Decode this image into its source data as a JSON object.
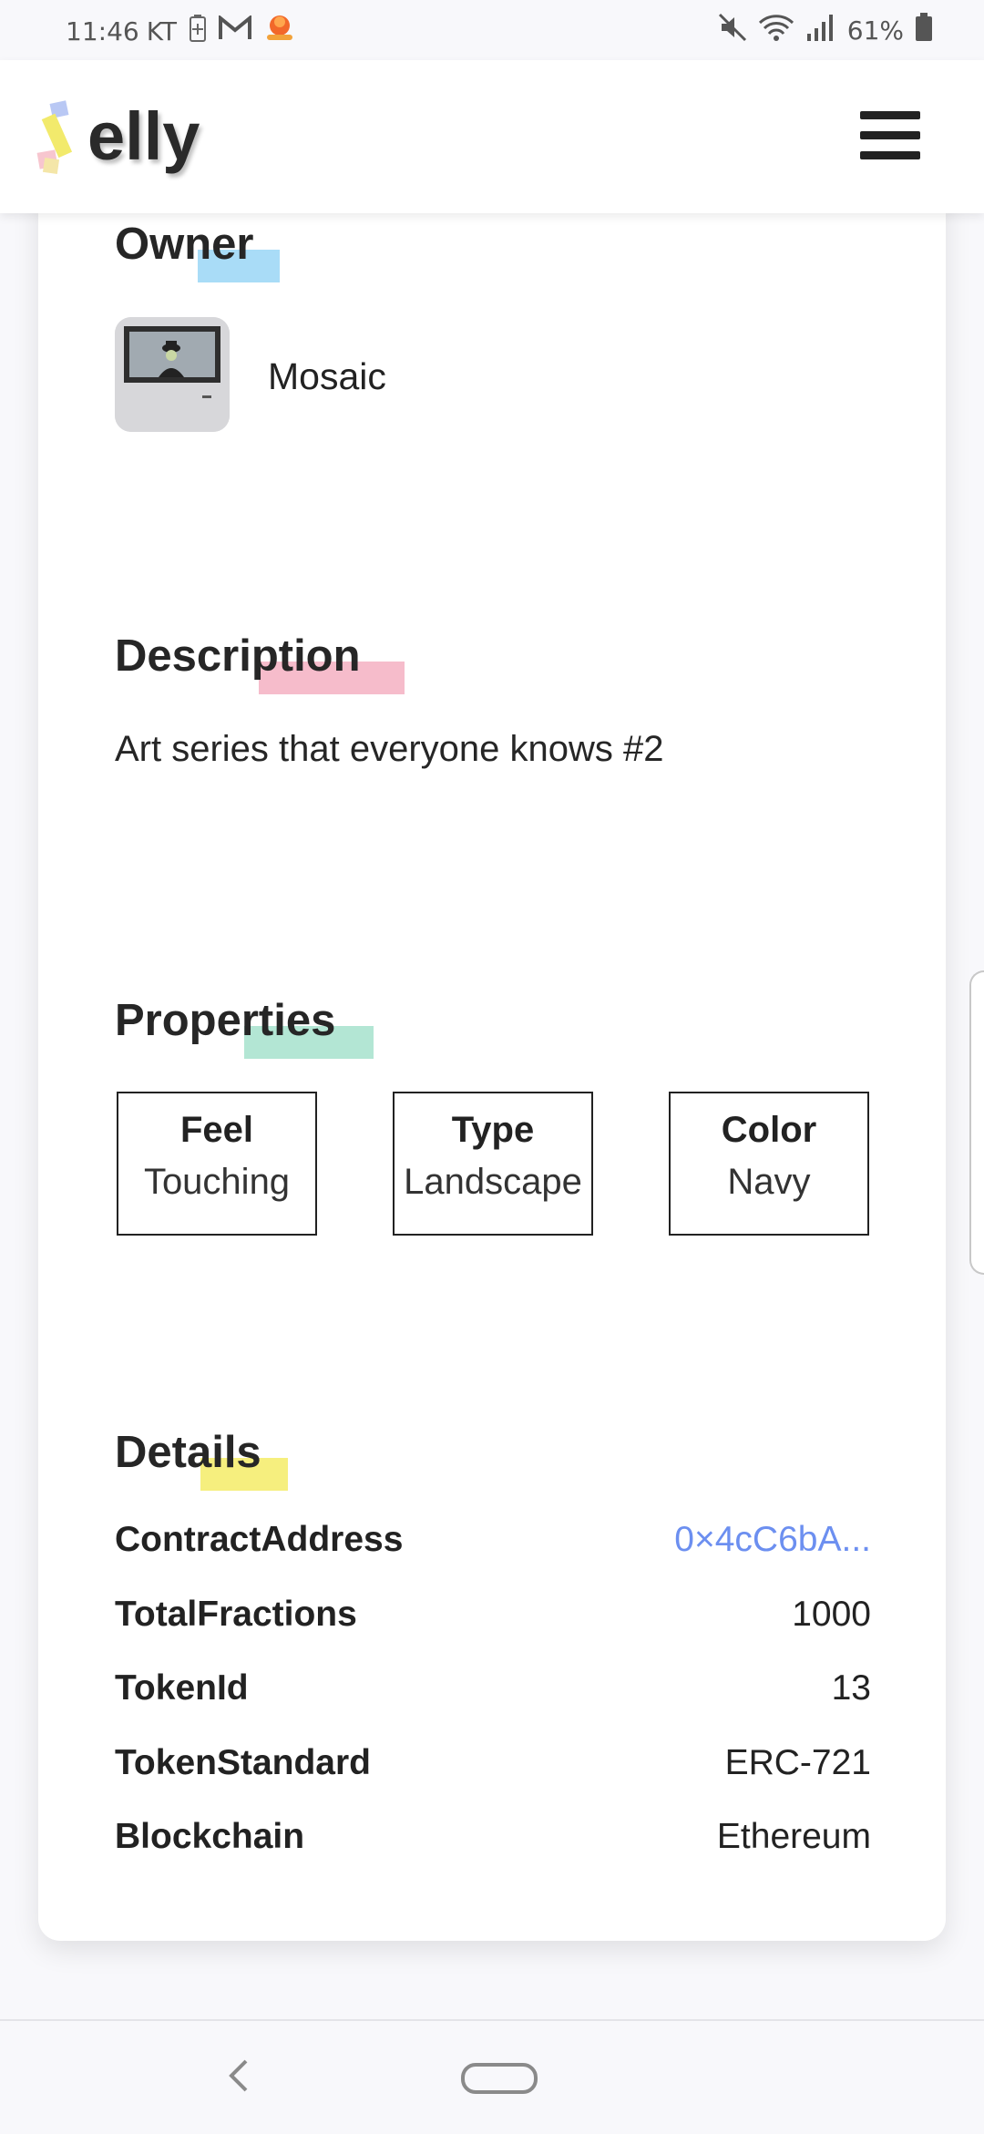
{
  "status_bar": {
    "time": "11:46",
    "carrier": "KT",
    "battery_percent": "61%",
    "icons": [
      "battery-saver-icon",
      "gmail-icon",
      "app-notification-icon",
      "mute-icon",
      "wifi-icon",
      "signal-icon",
      "battery-icon"
    ]
  },
  "header": {
    "logo_text": "elly",
    "menu_icon": "hamburger-menu-icon"
  },
  "owner": {
    "title": "Owner",
    "name": "Mosaic",
    "highlight_color": "#a9dcf7"
  },
  "description": {
    "title": "Description",
    "text": "Art series that everyone knows #2",
    "highlight_color": "#f6bccb"
  },
  "properties": {
    "title": "Properties",
    "highlight_color": "#b3e6d4",
    "items": [
      {
        "key": "Feel",
        "value": "Touching"
      },
      {
        "key": "Type",
        "value": "Landscape"
      },
      {
        "key": "Color",
        "value": "Navy"
      }
    ]
  },
  "details": {
    "title": "Details",
    "highlight_color": "#f6ef7e",
    "rows": [
      {
        "key": "ContractAddress",
        "value": "0×4cC6bA..."
      },
      {
        "key": "TotalFractions",
        "value": "1000"
      },
      {
        "key": "TokenId",
        "value": "13"
      },
      {
        "key": "TokenStandard",
        "value": "ERC-721"
      },
      {
        "key": "Blockchain",
        "value": "Ethereum"
      }
    ],
    "link_color": "#6c8ff0"
  },
  "nav_bar": {
    "icons": [
      "back-icon",
      "home-icon"
    ]
  }
}
